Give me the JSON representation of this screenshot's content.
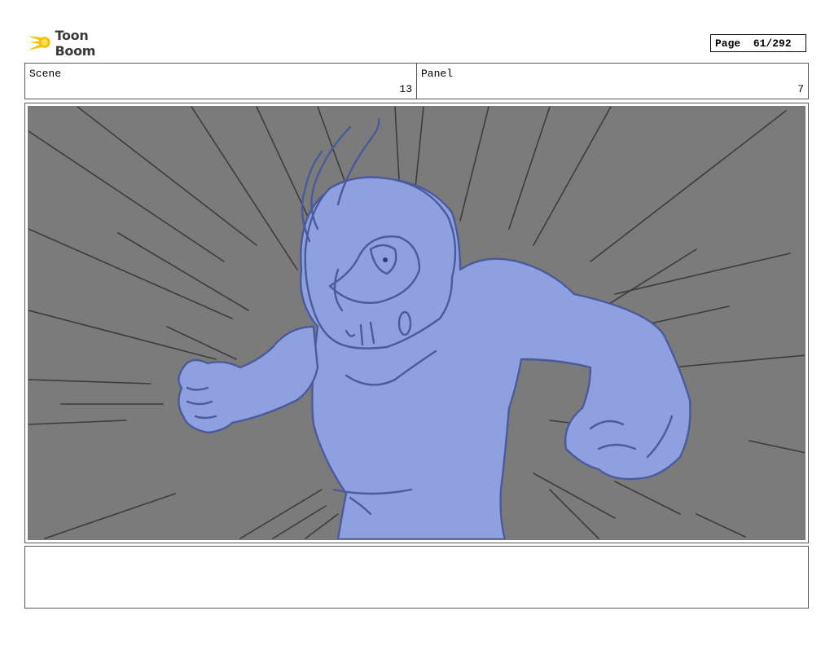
{
  "brand": {
    "name": "Toon Boom"
  },
  "page": {
    "label": "Page",
    "value": "61/292"
  },
  "header": {
    "scene_label": "Scene",
    "scene_value": "13",
    "panel_label": "Panel",
    "panel_value": "7"
  },
  "colors": {
    "background": "#7b7b7b",
    "figure_fill": "#8fa0e0",
    "figure_stroke": "#4a5a9a",
    "speed_lines": "#3c3c3c",
    "logo_yellow": "#f5c400"
  },
  "notes": {
    "text": ""
  }
}
